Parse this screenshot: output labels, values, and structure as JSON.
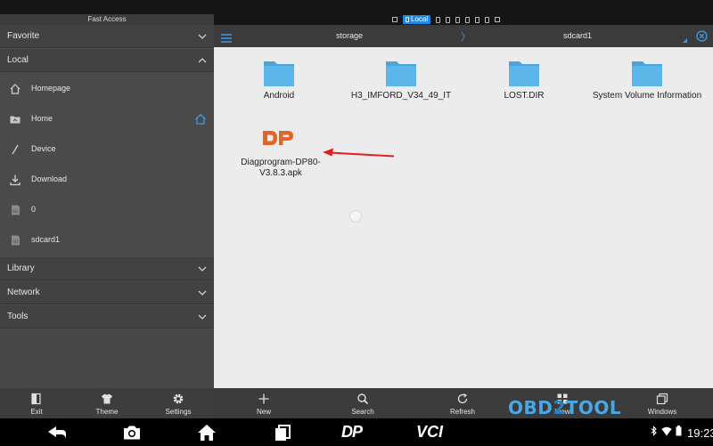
{
  "status_bar": {
    "fast_access": "Fast Access",
    "local_chip": "Local"
  },
  "sidebar": {
    "favorite": "Favorite",
    "local": "Local",
    "items": [
      {
        "label": "Homepage",
        "icon": "home-outline-icon"
      },
      {
        "label": "Home",
        "icon": "folder-home-icon"
      },
      {
        "label": "Device",
        "icon": "slash-device-icon"
      },
      {
        "label": "Download",
        "icon": "download-icon"
      },
      {
        "label": "0",
        "icon": "sd-card-icon"
      },
      {
        "label": "sdcard1",
        "icon": "sd-card-icon"
      }
    ],
    "library": "Library",
    "network": "Network",
    "tools": "Tools"
  },
  "breadcrumb": {
    "storage": "storage",
    "separator": "〉",
    "sdcard1": "sdcard1"
  },
  "files": {
    "folders": [
      "Android",
      "H3_IMFORD_V34_49_IT",
      "LOST.DIR",
      "System Volume Information"
    ],
    "apk": {
      "line1": "Diagprogram-DP80-",
      "line2": "V3.8.3.apk",
      "logo": "DP"
    }
  },
  "left_toolbar": [
    "Exit",
    "Theme",
    "Settings"
  ],
  "right_toolbar": [
    "New",
    "Search",
    "Refresh",
    "View",
    "Windows"
  ],
  "watermark": {
    "part1": "OBD",
    "part2": "2",
    "part3": "TOOL"
  },
  "nav_bar": {
    "dp_label": "DP",
    "vci_label": "VCI",
    "time": "19:23"
  },
  "colors": {
    "accent": "#3b9bea",
    "folder": "#5cb6ea",
    "dp_orange": "#e0662a",
    "arrow_red": "#e02020"
  }
}
